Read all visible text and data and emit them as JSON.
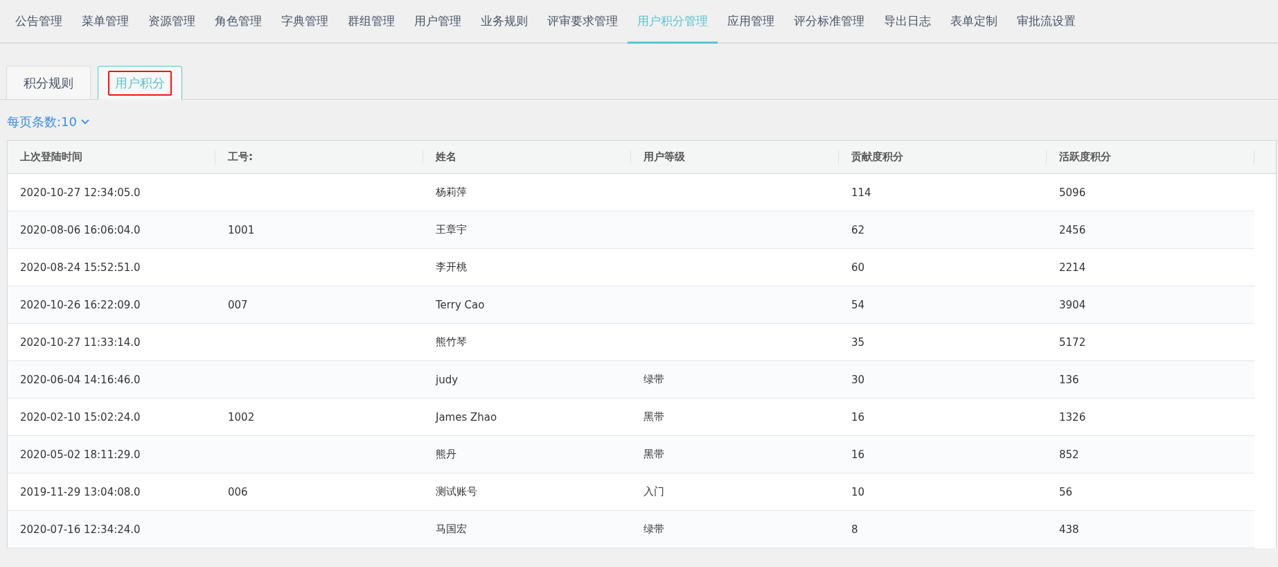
{
  "nav": [
    {
      "label": "公告管理",
      "selected": false
    },
    {
      "label": "菜单管理",
      "selected": false
    },
    {
      "label": "资源管理",
      "selected": false
    },
    {
      "label": "角色管理",
      "selected": false
    },
    {
      "label": "字典管理",
      "selected": false
    },
    {
      "label": "群组管理",
      "selected": false
    },
    {
      "label": "用户管理",
      "selected": false
    },
    {
      "label": "业务规则",
      "selected": false
    },
    {
      "label": "评审要求管理",
      "selected": false
    },
    {
      "label": "用户积分管理",
      "selected": true
    },
    {
      "label": "应用管理",
      "selected": false
    },
    {
      "label": "评分标准管理",
      "selected": false
    },
    {
      "label": "导出日志",
      "selected": false
    },
    {
      "label": "表单定制",
      "selected": false
    },
    {
      "label": "审批流设置",
      "selected": false
    }
  ],
  "tabs": [
    {
      "label": "积分规则",
      "selected": false,
      "highlighted": false
    },
    {
      "label": "用户积分",
      "selected": true,
      "highlighted": true
    }
  ],
  "page_size": "每页条数:10",
  "table": {
    "columns": [
      "上次登陆时间",
      "工号:",
      "姓名",
      "用户等级",
      "贡献度积分",
      "活跃度积分"
    ],
    "rows": [
      [
        "2020-10-27 12:34:05.0",
        "",
        "杨莉萍",
        "",
        "114",
        "5096"
      ],
      [
        "2020-08-06 16:06:04.0",
        "1001",
        "王章宇",
        "",
        "62",
        "2456"
      ],
      [
        "2020-08-24 15:52:51.0",
        "",
        "李开桃",
        "",
        "60",
        "2214"
      ],
      [
        "2020-10-26 16:22:09.0",
        "007",
        "Terry Cao",
        "",
        "54",
        "3904"
      ],
      [
        "2020-10-27 11:33:14.0",
        "",
        "熊竹琴",
        "",
        "35",
        "5172"
      ],
      [
        "2020-06-04 14:16:46.0",
        "",
        "judy",
        "绿带",
        "30",
        "136"
      ],
      [
        "2020-02-10 15:02:24.0",
        "1002",
        "James Zhao",
        "黑带",
        "16",
        "1326"
      ],
      [
        "2020-05-02 18:11:29.0",
        "",
        "熊丹",
        "黑带",
        "16",
        "852"
      ],
      [
        "2019-11-29 13:04:08.0",
        "006",
        "测试账号",
        "入门",
        "10",
        "56"
      ],
      [
        "2020-07-16 12:34:24.0",
        "",
        "马国宏",
        "绿带",
        "8",
        "438"
      ]
    ]
  }
}
